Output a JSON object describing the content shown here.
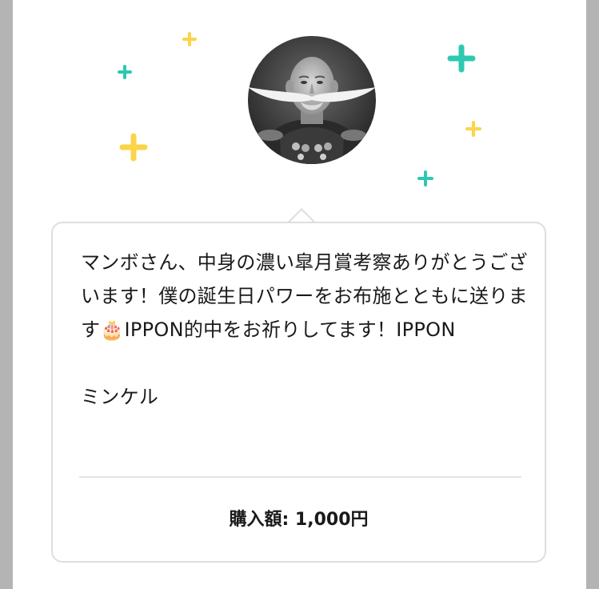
{
  "message": {
    "text": "マンボさん、中身の濃い皐月賞考察ありがとうございます！僕の誕生日パワーをお布施とともに送ります🎂IPPON的中をお祈りしてます！IPPON\n\nミンケル"
  },
  "purchase": {
    "amount_label": "購入額: 1,000円"
  },
  "icons": {
    "avatar": "avatar-icon",
    "sparkle": "sparkle-plus-icon"
  },
  "colors": {
    "sparkle_yellow": "#fbd548",
    "sparkle_teal": "#2dc9b0",
    "bubble_border": "#dedede"
  }
}
